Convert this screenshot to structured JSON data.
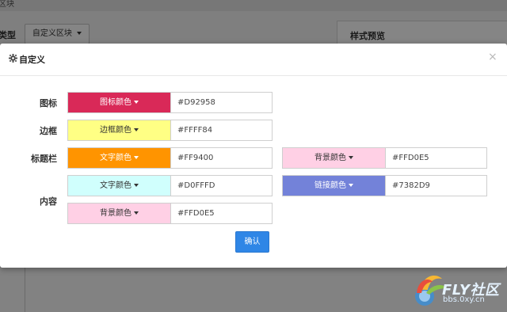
{
  "background": {
    "top_label": "区块",
    "type_label": "类型",
    "type_dropdown": "自定义区块",
    "preview_label": "样式预览"
  },
  "modal": {
    "title": "自定义",
    "close": "×",
    "confirm": "确认",
    "rows": {
      "icon": "图标",
      "border": "边框",
      "titlebar": "标题栏",
      "content": "内容"
    },
    "fields": {
      "icon_color": {
        "label": "图标颜色",
        "hex": "#D92958",
        "color": "#D92958",
        "text_color": "#ffffff"
      },
      "border_color": {
        "label": "边框颜色",
        "hex": "#FFFF84",
        "color": "#FFFF84",
        "text_color": "#333333"
      },
      "titlebar_text": {
        "label": "文字颜色",
        "hex": "#FF9400",
        "color": "#FF9400",
        "text_color": "#ffffff"
      },
      "titlebar_bg": {
        "label": "背景颜色",
        "hex": "#FFD0E5",
        "color": "#FFD0E5",
        "text_color": "#333333"
      },
      "content_text": {
        "label": "文字颜色",
        "hex": "#D0FFFD",
        "color": "#D0FFFD",
        "text_color": "#333333"
      },
      "content_link": {
        "label": "链接颜色",
        "hex": "#7382D9",
        "color": "#7382D9",
        "text_color": "#ffffff"
      },
      "content_bg": {
        "label": "背景颜色",
        "hex": "#FFD0E5",
        "color": "#FFD0E5",
        "text_color": "#333333"
      }
    }
  },
  "watermark": {
    "brand": "FLY社区",
    "url": "bbs.0xy.cn"
  }
}
